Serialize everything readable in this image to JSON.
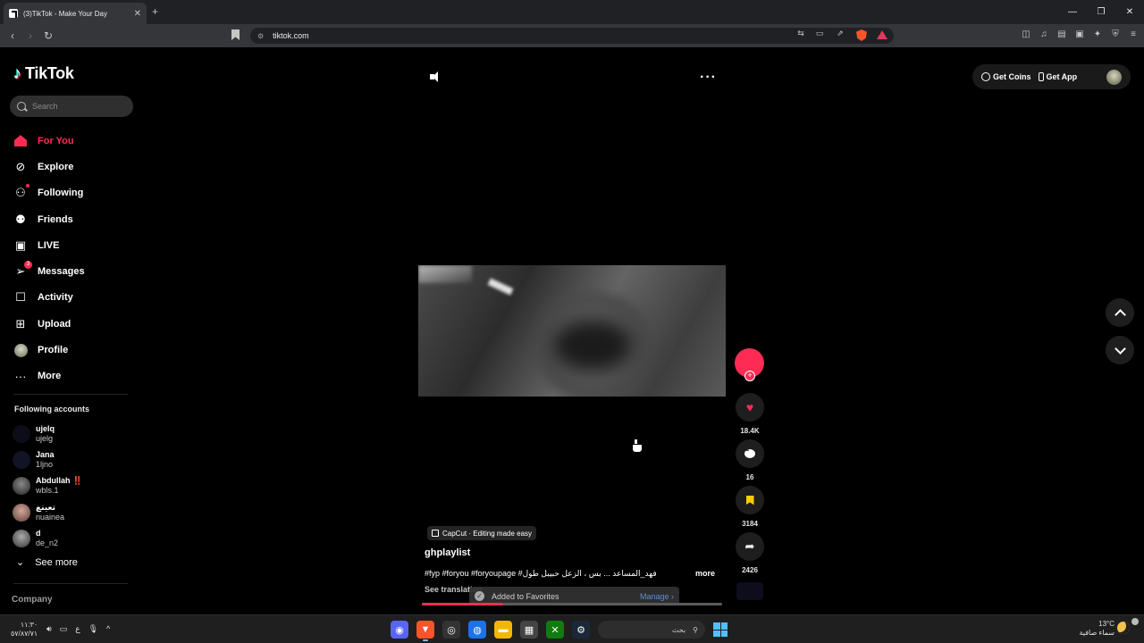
{
  "browser": {
    "tab_title": "(3)TikTok - Make Your Day",
    "url": "tiktok.com"
  },
  "logo": {
    "text": "TikTok"
  },
  "search": {
    "placeholder": "Search"
  },
  "menu": [
    {
      "label": "For You",
      "icon": "home-icon",
      "active": true
    },
    {
      "label": "Explore",
      "icon": "compass-icon"
    },
    {
      "label": "Following",
      "icon": "following-icon"
    },
    {
      "label": "Friends",
      "icon": "friends-icon"
    },
    {
      "label": "LIVE",
      "icon": "live-icon"
    },
    {
      "label": "Messages",
      "icon": "messages-icon",
      "badge": "3"
    },
    {
      "label": "Activity",
      "icon": "activity-icon"
    },
    {
      "label": "Upload",
      "icon": "upload-icon"
    },
    {
      "label": "Profile",
      "icon": "profile-avatar"
    },
    {
      "label": "More",
      "icon": "more-dots-icon"
    }
  ],
  "following_accounts": {
    "title": "Following accounts",
    "items": [
      {
        "name": "ujelq",
        "user": "ujelg"
      },
      {
        "name": "Jana",
        "user": "1ljno"
      },
      {
        "name": "Abdullah",
        "name_mark": "‼️",
        "user": "wbls.1"
      },
      {
        "name": "تعينغ",
        "user": "nuainea"
      },
      {
        "name": "d",
        "user": "de_n2"
      }
    ],
    "see_more": "See more"
  },
  "company": "Company",
  "video": {
    "capcut_label": "CapCut · Editing made easy",
    "author": "ghplaylist",
    "description": "#fyp #foryou #foryoupage #فهد_المساعد ... بس ، الزعل حبيبل طول",
    "more_label": "more",
    "see_translation": "See translation",
    "progress": 0.27
  },
  "actions": {
    "likes": "18.4K",
    "comments": "16",
    "saves": "3184",
    "shares": "2426"
  },
  "toast": {
    "message": "Added to Favorites",
    "manage": "Manage"
  },
  "header": {
    "get_coins": "Get Coins",
    "get_app": "Get App"
  },
  "taskbar": {
    "time": "١١:٣٠",
    "date": "٥٧/٨٧/٧١",
    "lang": "ع",
    "search_text": "بحث",
    "temperature": "13°C",
    "weather": "سماء صافية"
  },
  "colors": {
    "accent": "#fe2c55",
    "save": "#facd00"
  }
}
